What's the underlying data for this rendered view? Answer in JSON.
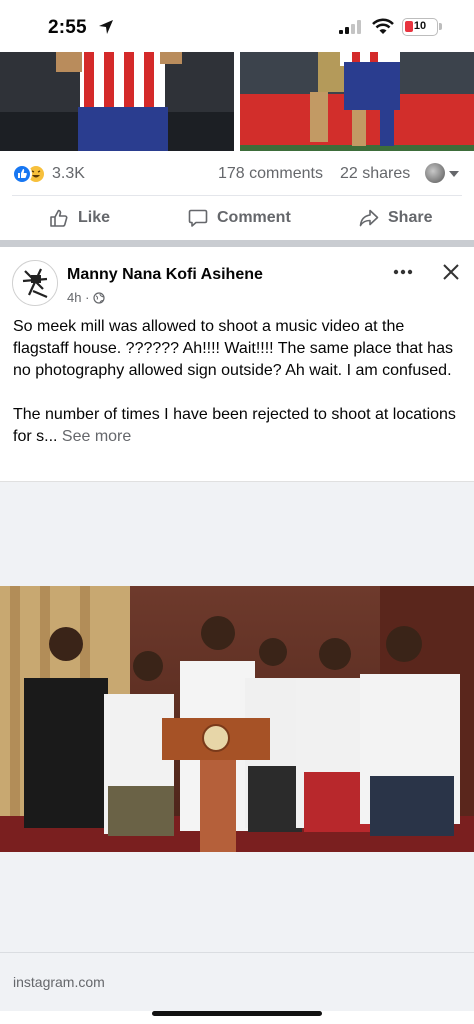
{
  "status_bar": {
    "time": "2:55",
    "battery": "10"
  },
  "prev_post": {
    "reaction_count": "3.3K",
    "comments": "178 comments",
    "shares": "22 shares",
    "actions": {
      "like": "Like",
      "comment": "Comment",
      "share": "Share"
    }
  },
  "post": {
    "author": "Manny Nana Kofi Asihene",
    "time": "4h ·",
    "text_p1": "So meek mill was allowed to shoot a music video at the flagstaff house. ?????? Ah!!!! Wait!!!! The same place that has no photography allowed sign outside? Ah wait. I am confused.",
    "text_p2": "The number of times I have been rejected to shoot at locations for s...",
    "see_more": "See more",
    "link_domain": "instagram.com"
  },
  "colors": {
    "accent": "#1877f2",
    "secondary_text": "#65676b",
    "separator": "#c9ccd1"
  }
}
